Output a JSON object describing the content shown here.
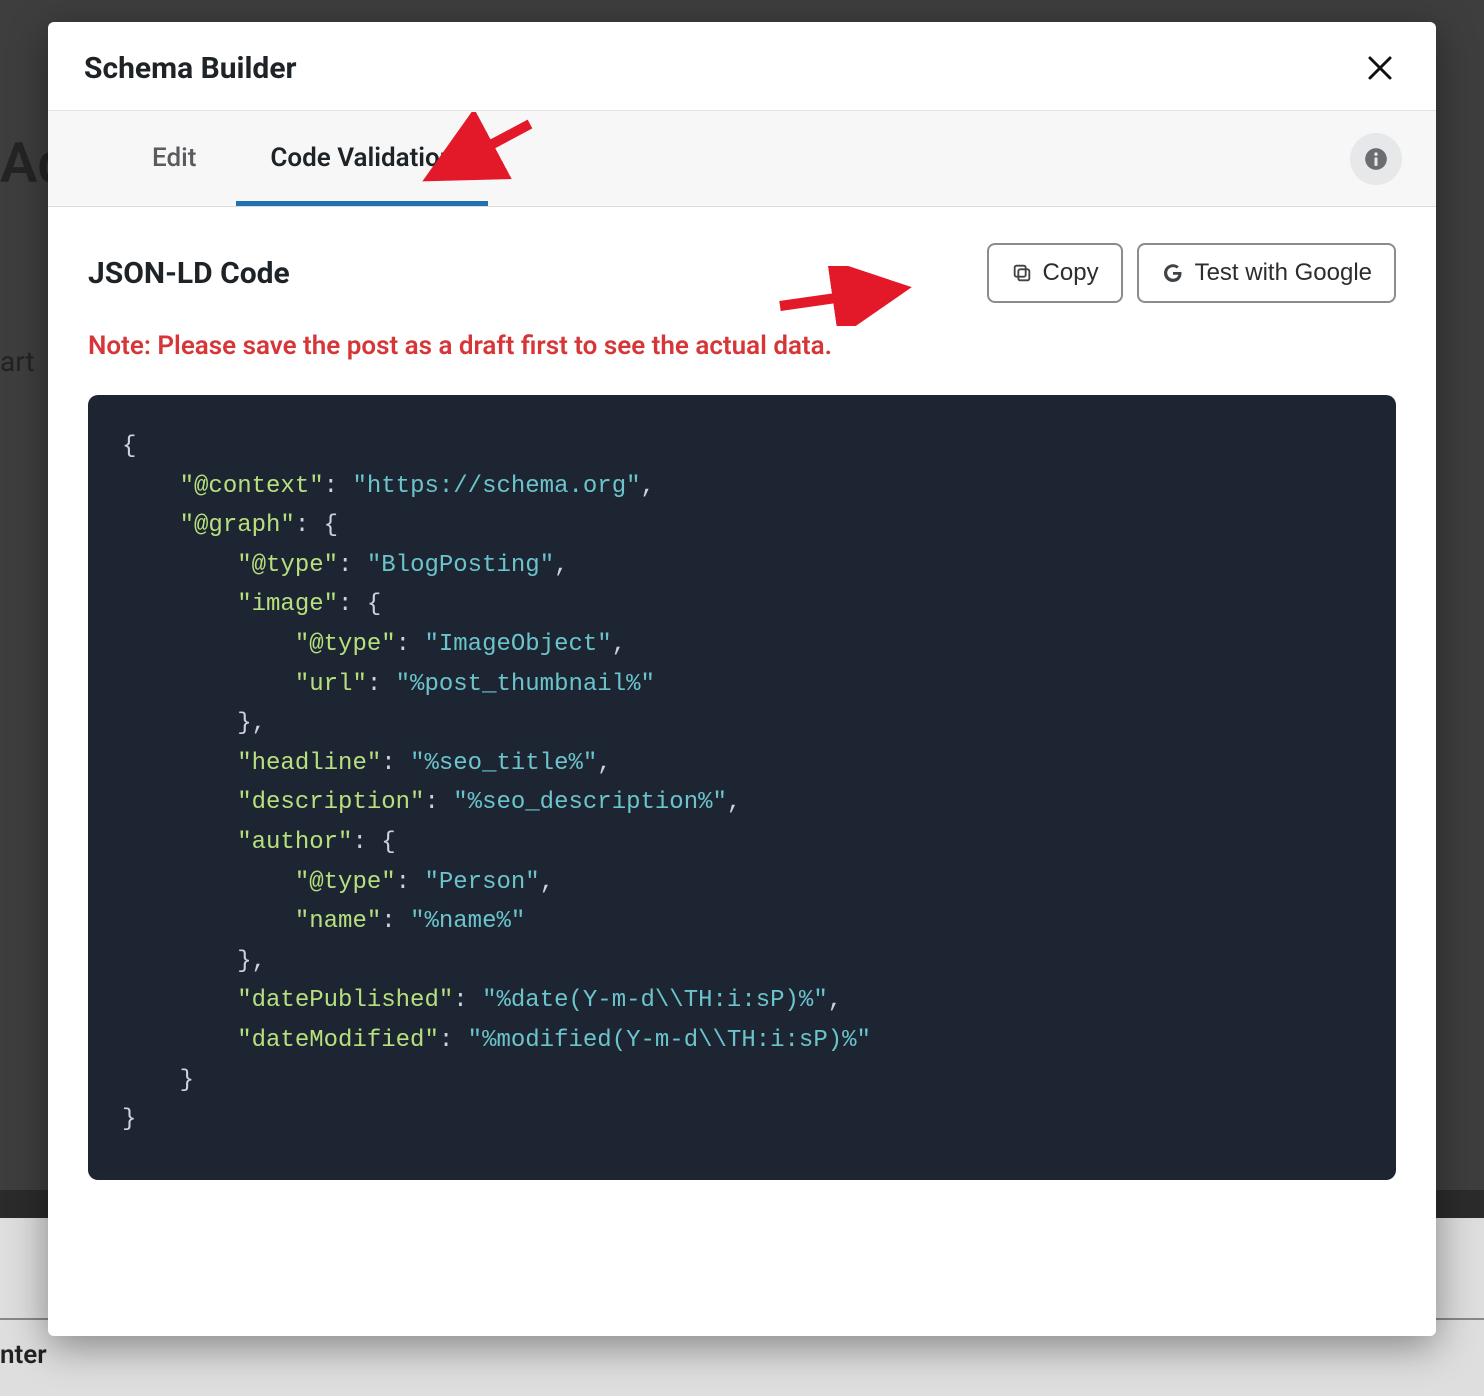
{
  "modal": {
    "title": "Schema Builder"
  },
  "tabs": {
    "edit": "Edit",
    "code_validation": "Code Validation"
  },
  "section": {
    "title": "JSON-LD Code"
  },
  "buttons": {
    "copy": "Copy",
    "test_google": "Test with Google"
  },
  "note": "Note: Please save the post as a draft first to see the actual data.",
  "code": {
    "context_key": "\"@context\"",
    "context_val": "\"https://schema.org\"",
    "graph_key": "\"@graph\"",
    "type_key": "\"@type\"",
    "type_val_blog": "\"BlogPosting\"",
    "image_key": "\"image\"",
    "type_val_imgobj": "\"ImageObject\"",
    "url_key": "\"url\"",
    "url_val": "\"%post_thumbnail%\"",
    "headline_key": "\"headline\"",
    "headline_val": "\"%seo_title%\"",
    "description_key": "\"description\"",
    "description_val": "\"%seo_description%\"",
    "author_key": "\"author\"",
    "type_val_person": "\"Person\"",
    "name_key": "\"name\"",
    "name_val": "\"%name%\"",
    "datePublished_key": "\"datePublished\"",
    "datePublished_val": "\"%date(Y-m-d\\\\TH:i:sP)%\"",
    "dateModified_key": "\"dateModified\"",
    "dateModified_val": "\"%modified(Y-m-d\\\\TH:i:sP)%\""
  },
  "background": {
    "title_fragment": "Ad",
    "sub_fragment": "art",
    "bottom_fragment": "nter"
  }
}
